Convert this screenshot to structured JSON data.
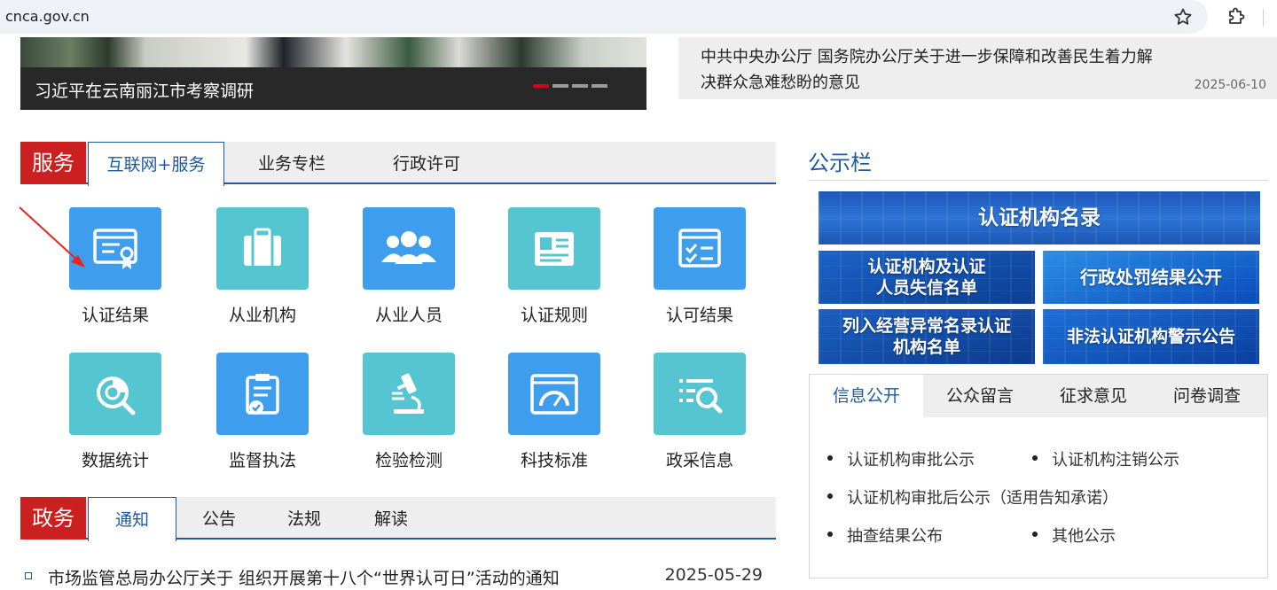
{
  "browser": {
    "url": "cnca.gov.cn"
  },
  "banner": {
    "caption": "习近平在云南丽江市考察调研"
  },
  "headline": {
    "text": "中共中央办公厅 国务院办公厅关于进一步保障和改善民生着力解决群众急难愁盼的意见",
    "date": "2025-06-10"
  },
  "service_section": {
    "label": "服务",
    "tabs": [
      "互联网+服务",
      "业务专栏",
      "行政许可"
    ],
    "active_tab": "互联网+服务",
    "items": [
      {
        "label": "认证结果",
        "icon": "certificate-icon",
        "color": "#3f9dee"
      },
      {
        "label": "从业机构",
        "icon": "briefcase-icon",
        "color": "#55c5d2"
      },
      {
        "label": "从业人员",
        "icon": "people-icon",
        "color": "#3f9dee"
      },
      {
        "label": "认证规则",
        "icon": "id-card-icon",
        "color": "#55c5d2"
      },
      {
        "label": "认可结果",
        "icon": "checklist-window-icon",
        "color": "#3f9dee"
      },
      {
        "label": "数据统计",
        "icon": "chart-search-icon",
        "color": "#55c5d2"
      },
      {
        "label": "监督执法",
        "icon": "clipboard-check-icon",
        "color": "#3f9dee"
      },
      {
        "label": "检验检测",
        "icon": "microscope-icon",
        "color": "#55c5d2"
      },
      {
        "label": "科技标准",
        "icon": "gauge-window-icon",
        "color": "#3f9dee"
      },
      {
        "label": "政采信息",
        "icon": "list-search-icon",
        "color": "#55c5d2"
      }
    ]
  },
  "gov_section": {
    "label": "政务",
    "tabs": [
      "通知",
      "公告",
      "法规",
      "解读"
    ],
    "active_tab": "通知",
    "news": [
      {
        "title": "市场监管总局办公厅关于 组织开展第十八个“世界认可日”活动的通知",
        "date": "2025-05-29"
      }
    ]
  },
  "notice_board": {
    "title": "公示栏",
    "promos": [
      {
        "text": "认证机构名录"
      },
      {
        "text": "认证机构及认证人员失信名单"
      },
      {
        "text": "行政处罚结果公开"
      },
      {
        "text": "列入经营异常名录认证机构名单"
      },
      {
        "text": "非法认证机构警示公告"
      }
    ]
  },
  "info_panel": {
    "tabs": [
      "信息公开",
      "公众留言",
      "征求意见",
      "问卷调查"
    ],
    "active_tab": "信息公开",
    "links": [
      "认证机构审批公示",
      "认证机构注销公示",
      "认证机构审批后公示（适用告知承诺）",
      "抽查结果公布",
      "其他公示"
    ]
  },
  "colors": {
    "brand_red": "#cc1f1f",
    "brand_blue": "#1e5a9c",
    "tile_blue": "#3f9dee",
    "tile_teal": "#55c5d2",
    "annotation_arrow": "#e8261c"
  }
}
